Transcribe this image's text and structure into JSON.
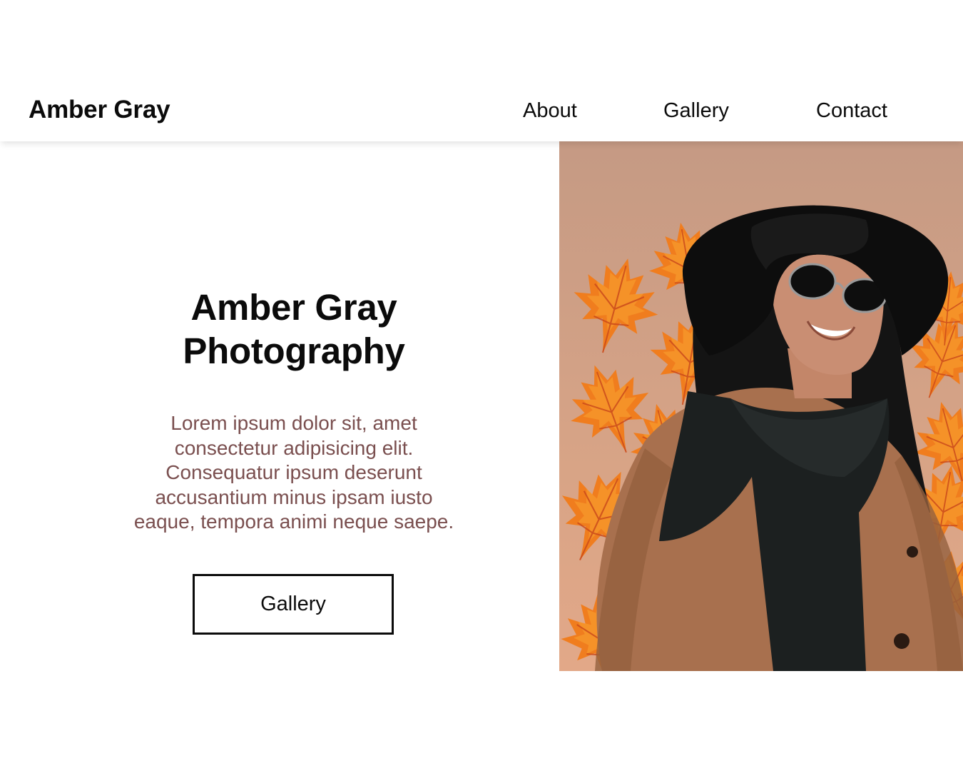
{
  "header": {
    "brand": "Amber Gray",
    "nav": [
      {
        "label": "About"
      },
      {
        "label": "Gallery"
      },
      {
        "label": "Contact"
      }
    ]
  },
  "hero": {
    "title_lines": [
      "Amber Gray",
      "Photography"
    ],
    "description_lines": [
      "Lorem ipsum dolor sit, amet",
      "consectetur adipisicing elit.",
      "Consequatur ipsum deserunt",
      "accusantium minus ipsam iusto",
      "eaque, tempora animi neque saepe."
    ],
    "button_label": "Gallery",
    "photo": {
      "subject": "woman in black hat and sunglasses with autumn maple leaves",
      "colors": {
        "background": "#d2a088",
        "leaf": "#f07d1e",
        "hat": "#0d0d0d",
        "coat": "#a8704e",
        "scarf": "#1c2020",
        "skin": "#c98e73"
      }
    }
  },
  "colors": {
    "text": "#0b0b0b",
    "description": "#7a4f4f",
    "background": "#ffffff"
  }
}
